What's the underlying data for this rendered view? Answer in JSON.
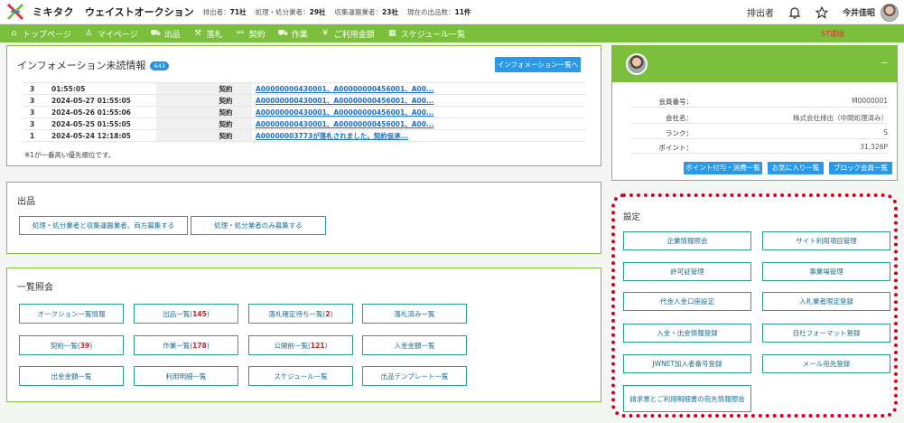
{
  "header": {
    "brand": "ミキタク",
    "brand2": "ウェイストオークション",
    "stats": [
      {
        "label": "排出者：",
        "value": "71社"
      },
      {
        "label": "処理・処分業者：",
        "value": "29社"
      },
      {
        "label": "収集運搬業者：",
        "value": "23社"
      },
      {
        "label": "現在の出品数：",
        "value": "11件"
      }
    ],
    "role": "排出者",
    "user_name": "今井佳昭"
  },
  "nav": {
    "items": [
      {
        "icon": "home-icon",
        "glyph": "⌂",
        "label": "トップページ"
      },
      {
        "icon": "user-icon",
        "glyph": "♙",
        "label": "マイページ"
      },
      {
        "icon": "truck-group-icon",
        "glyph": "⛟",
        "label": "出品"
      },
      {
        "icon": "gavel-icon",
        "glyph": "⚒",
        "label": "落札"
      },
      {
        "icon": "handshake-icon",
        "glyph": "⚯",
        "label": "契約"
      },
      {
        "icon": "truck-icon",
        "glyph": "⛟",
        "label": "作業"
      },
      {
        "icon": "yen-icon",
        "glyph": "¥",
        "label": "ご利用金額"
      },
      {
        "icon": "calendar-icon",
        "glyph": "▦",
        "label": "スケジュール一覧"
      }
    ],
    "env_label": "ST環境"
  },
  "info": {
    "title": "インフォメーション未読情報",
    "badge": "643",
    "list_button": "インフォメーション一覧へ",
    "rows": [
      {
        "num": "3",
        "datetime": "01:55:05",
        "type": "契約",
        "link": "A00000000430001、A00000000456001、A00..."
      },
      {
        "num": "3",
        "datetime": "2024-05-27 01:55:05",
        "type": "契約",
        "link": "A00000000430001、A00000000456001、A00..."
      },
      {
        "num": "3",
        "datetime": "2024-05-26 01:55:06",
        "type": "契約",
        "link": "A00000000430001、A00000000456001、A00..."
      },
      {
        "num": "3",
        "datetime": "2024-05-25 01:55:05",
        "type": "契約",
        "link": "A00000000430001、A00000000456001、A00..."
      },
      {
        "num": "1",
        "datetime": "2024-05-24 12:18:05",
        "type": "契約",
        "link": "A00000003773が落札されました。契約仮承..."
      }
    ],
    "note": "※1が一番高い優先順位です。"
  },
  "profile": {
    "minimize": "−",
    "rows": [
      {
        "label": "会員番号：",
        "value": "M0000001"
      },
      {
        "label": "会社名：",
        "value": "株式会社排出（中間処理済み）"
      },
      {
        "label": "ランク：",
        "value": "S"
      },
      {
        "label": "ポイント：",
        "value": "31,326P"
      }
    ],
    "buttons": [
      "ポイント付与・消費一覧",
      "お気に入り一覧",
      "ブロック会員一覧"
    ]
  },
  "listing": {
    "title": "出品",
    "buttons": [
      "処理・処分業者と収集運搬業者、両方募集する",
      "処理・処分業者のみ募集する"
    ]
  },
  "catalog": {
    "title": "一覧照会",
    "buttons": [
      {
        "label": "オークション一覧情報",
        "count": ""
      },
      {
        "label": "出品一覧",
        "count": "145"
      },
      {
        "label": "落札確定待ち一覧",
        "count": "2"
      },
      {
        "label": "落札済み一覧",
        "count": ""
      },
      {
        "label": "契約一覧",
        "count": "39"
      },
      {
        "label": "作業一覧",
        "count": "178"
      },
      {
        "label": "公開前一覧",
        "count": "121"
      },
      {
        "label": "入金金額一覧",
        "count": ""
      },
      {
        "label": "出金金額一覧",
        "count": ""
      },
      {
        "label": "利用明細一覧",
        "count": ""
      },
      {
        "label": "スケジュール一覧",
        "count": ""
      },
      {
        "label": "出品テンプレート一覧",
        "count": ""
      }
    ]
  },
  "settings": {
    "title": "設定",
    "buttons": [
      "企業情報照会",
      "サイト利用項目管理",
      "許可証管理",
      "事業場管理",
      "代金入金口座設定",
      "入札業者限定登録",
      "入金・出金情報登録",
      "自社フォーマット登録",
      "JWNET加入者番号登録",
      "メール宛先登録",
      "請求書とご利用明細書の宛先情報照会"
    ]
  },
  "colors": {
    "accent_green": "#7bbf3d",
    "info_blue": "#2a9ae8",
    "count_red": "#d21f1f",
    "highlight_border": "#d6001c"
  }
}
